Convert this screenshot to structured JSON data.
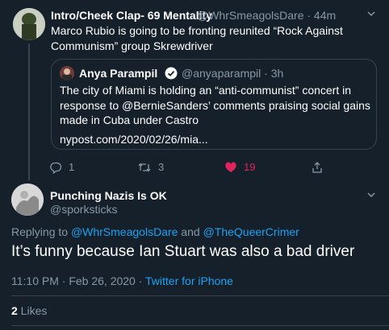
{
  "parent_tweet": {
    "display_name": "Intro/Cheek Clap- 69 Mentality",
    "handle_time": "@WhrSmeagolsDare · 44m",
    "text": "Marco Rubio is going to be fronting reunited “Rock Against Communism” group Skrewdriver",
    "quote": {
      "display_name": "Anya Parampil",
      "handle_time": "@anyaparampil · 3h",
      "text": "The city of Miami is holding an “anti-communist” concert in response to @BernieSanders’ comments praising social gains made in Cuba under Castro",
      "link": "nypost.com/2020/02/26/mia..."
    },
    "actions": {
      "reply_count": "1",
      "retweet_count": "3",
      "like_count": "19",
      "like_color": "#e0245e"
    }
  },
  "main_tweet": {
    "display_name": "Punching Nazis Is OK",
    "handle": "@sporksticks",
    "replying_prefix": "Replying to ",
    "replying_user1": "@WhrSmeagolsDare",
    "replying_and": " and ",
    "replying_user2": "@TheQueerCrimer",
    "text": "It’s funny because Ian Stuart  was also a bad driver",
    "timestamp": "11:10 PM · Feb 26, 2020 · ",
    "source": "Twitter for iPhone",
    "likes_count": "2",
    "likes_label": " Likes"
  },
  "theme": {
    "background": "#15202b",
    "secondary_text": "#8899a6",
    "link": "#1da1f2",
    "border": "#38444d"
  }
}
